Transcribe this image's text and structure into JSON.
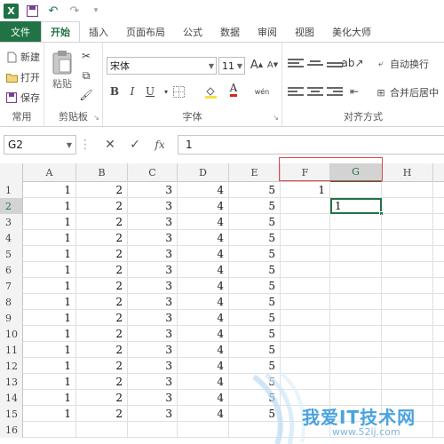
{
  "quick_access": {
    "app_logo": "X",
    "icons": [
      "save-icon",
      "undo-icon",
      "redo-icon",
      "customize-icon"
    ]
  },
  "tabs": [
    "文件",
    "开始",
    "插入",
    "页面布局",
    "公式",
    "数据",
    "审阅",
    "视图",
    "美化大师"
  ],
  "ribbon": {
    "common": {
      "new_label": "新建",
      "open_label": "打开",
      "save_label": "保存",
      "group_label": "常用"
    },
    "clipboard": {
      "paste_label": "粘贴",
      "group_label": "剪贴板"
    },
    "font": {
      "font_name": "宋体",
      "font_size": "11",
      "grow_label": "A",
      "shrink_label": "A",
      "bold": "B",
      "italic": "I",
      "underline": "U",
      "font_color_label": "A",
      "group_label": "字体"
    },
    "alignment": {
      "wrap_label": "自动换行",
      "merge_label": "合并后居中",
      "group_label": "对齐方式"
    }
  },
  "formula_bar": {
    "name_box": "G2",
    "cancel_label": "✕",
    "enter_label": "✓",
    "fx_label": "fx",
    "formula": "1"
  },
  "columns": [
    "A",
    "B",
    "C",
    "D",
    "E",
    "F",
    "G",
    "H"
  ],
  "rows": [
    {
      "n": "1",
      "A": "1",
      "B": "2",
      "C": "3",
      "D": "4",
      "E": "5",
      "F": "1",
      "G": ""
    },
    {
      "n": "2",
      "A": "1",
      "B": "2",
      "C": "3",
      "D": "4",
      "E": "5",
      "F": "",
      "G": "1"
    },
    {
      "n": "3",
      "A": "1",
      "B": "2",
      "C": "3",
      "D": "4",
      "E": "5",
      "F": "",
      "G": ""
    },
    {
      "n": "4",
      "A": "1",
      "B": "2",
      "C": "3",
      "D": "4",
      "E": "5",
      "F": "",
      "G": ""
    },
    {
      "n": "5",
      "A": "1",
      "B": "2",
      "C": "3",
      "D": "4",
      "E": "5",
      "F": "",
      "G": ""
    },
    {
      "n": "6",
      "A": "1",
      "B": "2",
      "C": "3",
      "D": "4",
      "E": "5",
      "F": "",
      "G": ""
    },
    {
      "n": "7",
      "A": "1",
      "B": "2",
      "C": "3",
      "D": "4",
      "E": "5",
      "F": "",
      "G": ""
    },
    {
      "n": "8",
      "A": "1",
      "B": "2",
      "C": "3",
      "D": "4",
      "E": "5",
      "F": "",
      "G": ""
    },
    {
      "n": "9",
      "A": "1",
      "B": "2",
      "C": "3",
      "D": "4",
      "E": "5",
      "F": "",
      "G": ""
    },
    {
      "n": "10",
      "A": "1",
      "B": "2",
      "C": "3",
      "D": "4",
      "E": "5",
      "F": "",
      "G": ""
    },
    {
      "n": "11",
      "A": "1",
      "B": "2",
      "C": "3",
      "D": "4",
      "E": "5",
      "F": "",
      "G": ""
    },
    {
      "n": "12",
      "A": "1",
      "B": "2",
      "C": "3",
      "D": "4",
      "E": "5",
      "F": "",
      "G": ""
    },
    {
      "n": "13",
      "A": "1",
      "B": "2",
      "C": "3",
      "D": "4",
      "E": "5",
      "F": "",
      "G": ""
    },
    {
      "n": "14",
      "A": "1",
      "B": "2",
      "C": "3",
      "D": "4",
      "E": "5",
      "F": "",
      "G": ""
    },
    {
      "n": "15",
      "A": "1",
      "B": "2",
      "C": "3",
      "D": "4",
      "E": "5",
      "F": "",
      "G": ""
    },
    {
      "n": "16",
      "A": "",
      "B": "",
      "C": "",
      "D": "",
      "E": "",
      "F": "",
      "G": ""
    }
  ],
  "selected_cell": "G2",
  "watermark": {
    "title": "我爱IT技术网",
    "subtitle": "www.52ij.com"
  },
  "colors": {
    "accent": "#217346",
    "highlight": "#e24a4a",
    "watermark": "#4aa3df"
  }
}
